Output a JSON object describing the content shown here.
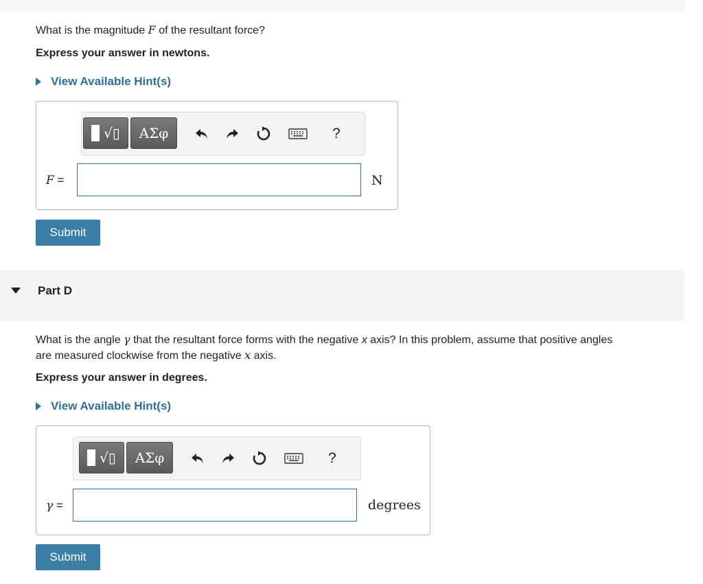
{
  "partC": {
    "question_pre": "What is the magnitude ",
    "question_var": "F",
    "question_post": " of the resultant force?",
    "instruction": "Express your answer in newtons.",
    "hint": "View Available Hint(s)",
    "toolbar": {
      "symbols_label": "ΑΣφ",
      "help_label": "?"
    },
    "var_symbol": "F",
    "var_eq": " =",
    "answer_value": "",
    "unit": "N",
    "submit": "Submit"
  },
  "partD": {
    "title": "Part D",
    "question_line1_pre": "What is the angle ",
    "question_line1_var": "γ",
    "question_line1_mid": " that the resultant force forms with the negative ",
    "question_line1_x": "x",
    "question_line1_post": " axis? In this problem, assume that positive angles",
    "question_line2_pre": "are measured  clockwise from the negative ",
    "question_line2_x": "x",
    "question_line2_post": " axis.",
    "instruction": "Express your answer in degrees.",
    "hint": "View Available Hint(s)",
    "toolbar": {
      "symbols_label": "ΑΣφ",
      "help_label": "?"
    },
    "var_symbol": "γ",
    "var_eq": " =",
    "answer_value": "",
    "unit": "degrees",
    "submit": "Submit"
  }
}
